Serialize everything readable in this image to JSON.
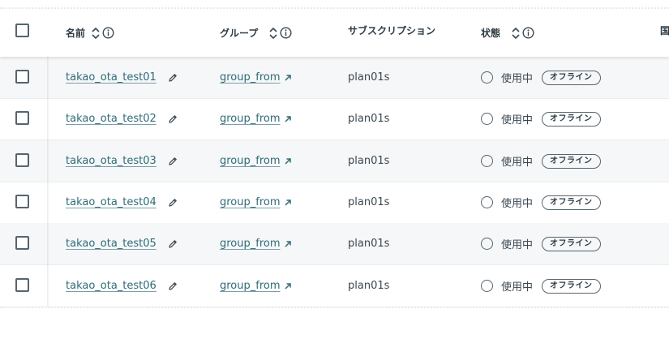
{
  "columns": {
    "name": "名前",
    "group": "グループ",
    "subscription": "サブスクリプション",
    "status": "状態",
    "country_partial": "国"
  },
  "rows": [
    {
      "name": "takao_ota_test01",
      "group": "group_from",
      "subscription": "plan01s",
      "status": "使用中",
      "connectivity": "オフライン"
    },
    {
      "name": "takao_ota_test02",
      "group": "group_from",
      "subscription": "plan01s",
      "status": "使用中",
      "connectivity": "オフライン"
    },
    {
      "name": "takao_ota_test03",
      "group": "group_from",
      "subscription": "plan01s",
      "status": "使用中",
      "connectivity": "オフライン"
    },
    {
      "name": "takao_ota_test04",
      "group": "group_from",
      "subscription": "plan01s",
      "status": "使用中",
      "connectivity": "オフライン"
    },
    {
      "name": "takao_ota_test05",
      "group": "group_from",
      "subscription": "plan01s",
      "status": "使用中",
      "connectivity": "オフライン"
    },
    {
      "name": "takao_ota_test06",
      "group": "group_from",
      "subscription": "plan01s",
      "status": "使用中",
      "connectivity": "オフライン"
    }
  ],
  "icons": {
    "sort": "sort-updown-icon",
    "info": "info-circle-icon",
    "edit": "pencil-icon",
    "external": "external-link-icon"
  },
  "colors": {
    "link": "#2f6b77",
    "row_alt": "#f5f7f8",
    "border": "#56646e"
  }
}
